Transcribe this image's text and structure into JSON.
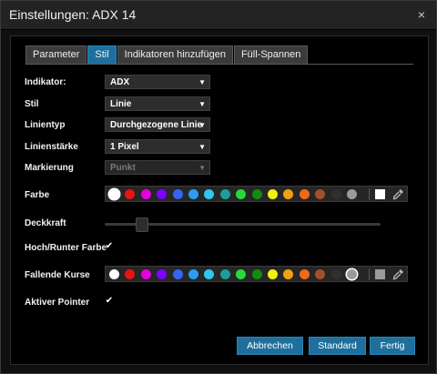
{
  "dialog": {
    "title": "Einstellungen: ADX 14",
    "close_glyph": "×"
  },
  "tabs": [
    {
      "label": "Parameter",
      "active": false
    },
    {
      "label": "Stil",
      "active": true
    },
    {
      "label": "Indikatoren hinzufügen",
      "active": false
    },
    {
      "label": "Füll-Spannen",
      "active": false
    }
  ],
  "fields": {
    "indikator": {
      "label": "Indikator:",
      "value": "ADX"
    },
    "stil": {
      "label": "Stil",
      "value": "Linie"
    },
    "linientyp": {
      "label": "Linientyp",
      "value": "Durchgezogene Linie"
    },
    "linienstaerke": {
      "label": "Linienstärke",
      "value": "1 Pixel"
    },
    "markierung": {
      "label": "Markierung",
      "value": "Punkt",
      "disabled": true
    },
    "farbe": {
      "label": "Farbe"
    },
    "deckkraft": {
      "label": "Deckkraft",
      "level_percent": 13
    },
    "hoch_runter": {
      "label": "Hoch/Runter Farbe",
      "checked": true,
      "glyph": "✔"
    },
    "fallende": {
      "label": "Fallende Kurse"
    },
    "aktiver_pointer": {
      "label": "Aktiver Pointer",
      "checked": true,
      "glyph": "✔"
    }
  },
  "palette_colors": [
    "#ffffff",
    "#e81313",
    "#e200e2",
    "#8000ff",
    "#3565f0",
    "#2e9bf0",
    "#31c6f0",
    "#1d9c9c",
    "#29d83a",
    "#138a13",
    "#f0f013",
    "#f0a013",
    "#f06a13",
    "#a0522d",
    "#303030",
    "#9a9a9a"
  ],
  "farbe_selected_index": 0,
  "fallende_selected_index": 15,
  "farbe_square_color": "#ffffff",
  "fallende_square_color": "#9a9a9a",
  "buttons": {
    "abbrechen": "Abbrechen",
    "standard": "Standard",
    "fertig": "Fertig"
  },
  "icons": {
    "dropdown": "chevron-down-icon",
    "picker": "eyedropper-icon",
    "close": "close-icon"
  }
}
